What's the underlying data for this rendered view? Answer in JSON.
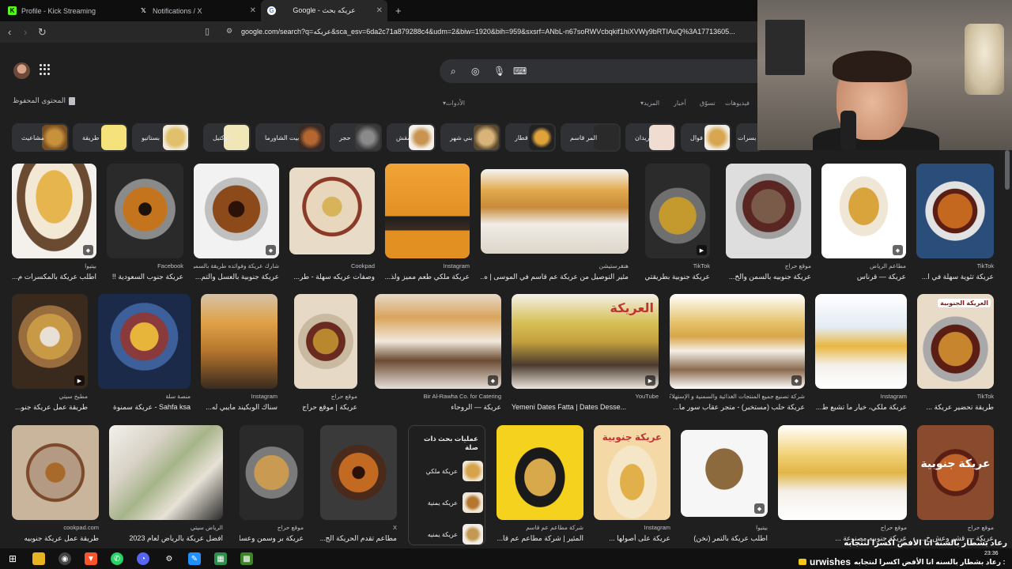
{
  "browser": {
    "tabs": [
      {
        "title": "Profile - Kick Streaming",
        "icon": "kick-icon",
        "color": "#53fc18"
      },
      {
        "title": "Notifications / X",
        "icon": "x-logo-icon",
        "color": "#ffffff"
      },
      {
        "title": "Google - عريكه بحث",
        "icon": "google-icon",
        "color": "#4285f4"
      }
    ],
    "new_tab": "+",
    "url": "google.com/search?q=عريكه&sca_esv=6da2c71a879288c4&udm=2&biw=1920&bih=959&sxsrf=ANbL-n67soRWVcbqkif1hiXVWy9bRTIAuQ%3A17713605..."
  },
  "google": {
    "saved_label": "المحتوى المحفوظ",
    "filters": {
      "videos": "فيديوهات",
      "shopping": "تسوّق",
      "news": "أخبار",
      "more": "المزيد",
      "tools": "الأدوات"
    },
    "chips": [
      "مشاعيث",
      "طريقة",
      "بستاتيو",
      "كوكتيل",
      "بيت الشاورما",
      "حجر",
      "مقش",
      "بني شهر",
      "قطار",
      "المر قاسم",
      "ريدان",
      "فوال",
      "بسرات"
    ],
    "row1": [
      {
        "source": "بيتيوا",
        "title": "اطلب عريكة بالمكسرات م..."
      },
      {
        "source": "Facebook",
        "title": "عريكة جنوب السعودية !!"
      },
      {
        "source": "شارك عريكة وفوائده طريقة بالسمن عالمية",
        "title": "عريكة جنوبية بالعسل والتم..."
      },
      {
        "source": "Cookpad",
        "title": "وصفات عريكه سهلة - طر..."
      },
      {
        "source": "Instagram",
        "title": "عريكة ملكي طعم مميز ولذ..."
      },
      {
        "source": "هنقرستيشن",
        "title": "مئير التوصيل من عريكة عم قاسم في الموسى | ه..."
      },
      {
        "source": "TikTok",
        "title": "عريكة جنوبية بطريقتي..."
      },
      {
        "source": "موقع حراج",
        "title": "عريكة جنوبيه بالسمن والخ..."
      },
      {
        "source": "مطاعم الرياض",
        "title": "عريكة — قرناس"
      },
      {
        "source": "TikTok",
        "title": "عريكة تثوية سهلة في ا..."
      }
    ],
    "row2": [
      {
        "source": "مطبخ سيتي",
        "title": "طريقة عمل عريكة جنو..."
      },
      {
        "source": "منصة سلة",
        "title": "Sahfa ksa - عريكة سمنوة"
      },
      {
        "source": "Instagram",
        "title": "سناك الوبكيند مايبي له..."
      },
      {
        "source": "موقع حراج",
        "title": "عريكة | موقع حراج"
      },
      {
        "source": "Bir Al-Rawha Co. for Catering",
        "title": "عريكة — الروحاء"
      },
      {
        "source": "YouTube",
        "title": "Yemeni Dates Fatta | Dates Desse..."
      },
      {
        "source": "شركة تصنيع جميع المنتجات الغذائية والسمنية و الإستهلاكية",
        "title": "عريكة حلب (مستخبر) - متجر عقاب سور ما..."
      },
      {
        "source": "Instagram",
        "title": "عريكة ملكي، خيار ما تشبع ط..."
      },
      {
        "source": "TikTok",
        "title": "طريقة تحضير عريكة ..."
      }
    ],
    "row3": [
      {
        "source": "cookpad.com",
        "title": "طريقة عمل عريكة جنوبيه"
      },
      {
        "source": "الرياض سيتي",
        "title": "افضل عريكة بالرياض لعام 2023"
      },
      {
        "source": "موقع حراج",
        "title": "عريكة بر وسمن وعسل..."
      },
      {
        "source": "X",
        "title": "مطاعم تقدم الحريكة الج..."
      },
      {
        "source": "شركة مطاعم عم قاسم",
        "title": "المئير | شركة مطاعم عم قا..."
      },
      {
        "source": "Instagram",
        "title": "عريكة على أصولها ..."
      },
      {
        "source": "بيتيوا",
        "title": "اطلب عريكة بالتمر (نخن)"
      },
      {
        "source": "موقع حراج",
        "title": "عريكة جنوبيه مصنوعة ..."
      },
      {
        "source": "موقع حراج",
        "title": "عريكة — قشر وعش خ..."
      }
    ],
    "related": {
      "heading": "عمليات بحث ذات صلة",
      "items": [
        "عريكة ملكي",
        "عريكه يمنية",
        "عريكة يمنيه"
      ]
    },
    "image_texts": {
      "arika_sign": "العريكة",
      "arika_jnoubia": "عريكة جنوبية",
      "arika_label": "العريكة الجنوبية"
    }
  },
  "stream": {
    "ticker": "رعاد بشطار بالسنة انا الأفض اكسرا لنتجابه",
    "username": "urwishes",
    "message": ": رعاد بشطار بالسنه انا الأفض اكسرا لنتجابه",
    "time": "23:36"
  }
}
